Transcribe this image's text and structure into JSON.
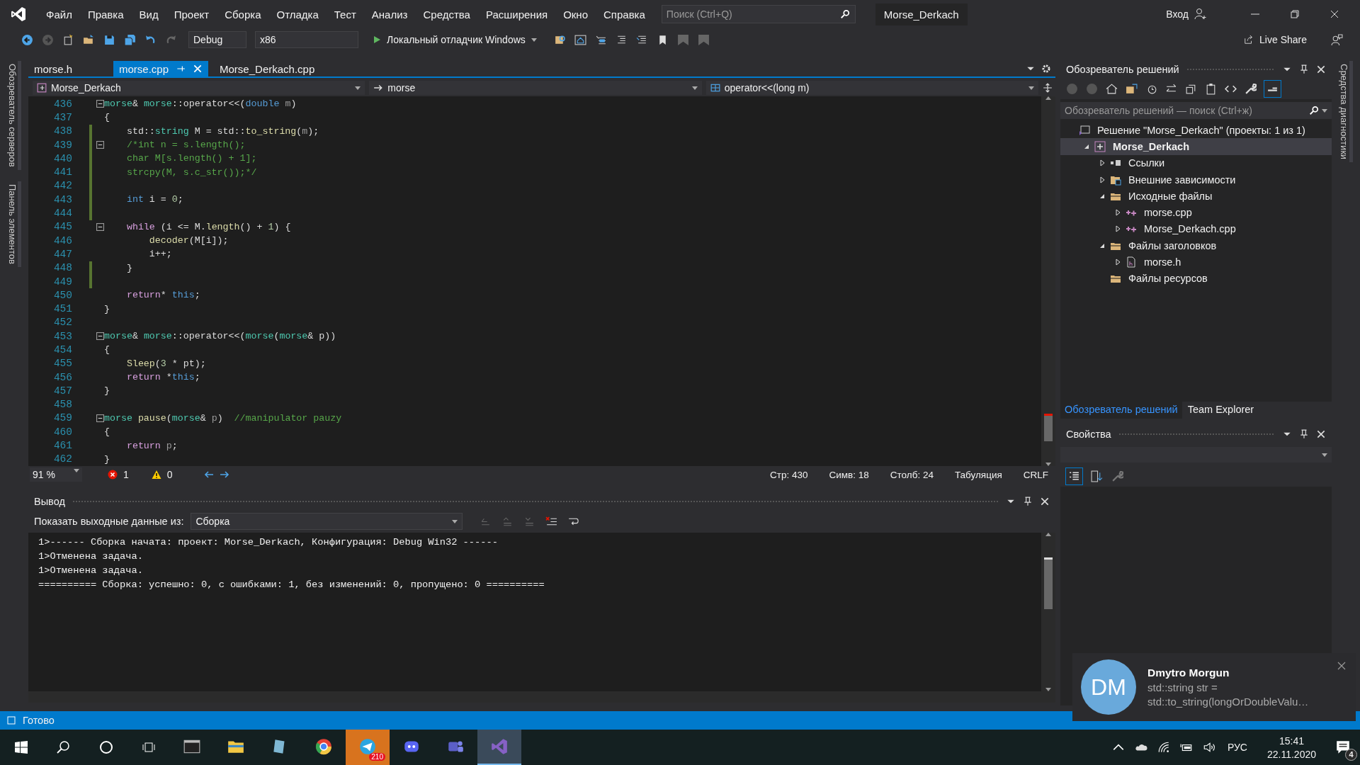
{
  "menu": {
    "items": [
      "Файл",
      "Правка",
      "Вид",
      "Проект",
      "Сборка",
      "Отладка",
      "Тест",
      "Анализ",
      "Средства",
      "Расширения",
      "Окно",
      "Справка"
    ]
  },
  "search": {
    "placeholder": "Поиск (Ctrl+Q)"
  },
  "window": {
    "title": "Morse_Derkach"
  },
  "account": {
    "label": "Вход"
  },
  "toolbar": {
    "configuration": "Debug",
    "platform": "x86",
    "debugger": "Локальный отладчик Windows",
    "live_share": "Live Share"
  },
  "side_tabs_left": [
    "Обозреватель серверов",
    "Панель элементов"
  ],
  "side_tabs_right": [
    "Средства диагностики"
  ],
  "editor": {
    "tabs": [
      {
        "label": "morse.h",
        "selected": false
      },
      {
        "label": "morse.cpp",
        "selected": true
      },
      {
        "label": "Morse_Derkach.cpp",
        "selected": false
      }
    ],
    "navigation": [
      "Morse_Derkach",
      "morse",
      "operator<<(long m)"
    ],
    "lines": [
      {
        "number": "436",
        "changed": false,
        "fold": true,
        "tokens": [
          {
            "kind": "type",
            "text": "morse"
          },
          {
            "kind": "plain",
            "text": "& "
          },
          {
            "kind": "type",
            "text": "morse"
          },
          {
            "kind": "plain",
            "text": "::operator<<("
          },
          {
            "kind": "keyword",
            "text": "double"
          },
          {
            "kind": "param",
            "text": " m"
          },
          {
            "kind": "plain",
            "text": ")"
          }
        ]
      },
      {
        "number": "437",
        "changed": false,
        "fold": false,
        "tokens": [
          {
            "kind": "plain",
            "text": "{"
          }
        ]
      },
      {
        "number": "438",
        "changed": true,
        "fold": false,
        "tokens": [
          {
            "kind": "plain",
            "text": "    std::"
          },
          {
            "kind": "type",
            "text": "string"
          },
          {
            "kind": "plain",
            "text": " M = std::"
          },
          {
            "kind": "function",
            "text": "to_string"
          },
          {
            "kind": "plain",
            "text": "("
          },
          {
            "kind": "param",
            "text": "m"
          },
          {
            "kind": "plain",
            "text": ");"
          }
        ]
      },
      {
        "number": "439",
        "changed": true,
        "fold": true,
        "tokens": [
          {
            "kind": "comment",
            "text": "    /*int n = s.length();"
          }
        ]
      },
      {
        "number": "440",
        "changed": true,
        "fold": false,
        "tokens": [
          {
            "kind": "comment",
            "text": "    char M[s.length() + 1];"
          }
        ]
      },
      {
        "number": "441",
        "changed": true,
        "fold": false,
        "tokens": [
          {
            "kind": "comment",
            "text": "    strcpy(M, s.c_str());*/"
          }
        ]
      },
      {
        "number": "442",
        "changed": true,
        "fold": false
      },
      {
        "number": "443",
        "changed": true,
        "fold": false,
        "tokens": [
          {
            "kind": "keyword",
            "text": "    int"
          },
          {
            "kind": "plain",
            "text": " i = "
          },
          {
            "kind": "number",
            "text": "0"
          },
          {
            "kind": "plain",
            "text": ";"
          }
        ]
      },
      {
        "number": "444",
        "changed": true,
        "fold": false
      },
      {
        "number": "445",
        "changed": false,
        "fold": true,
        "tokens": [
          {
            "kind": "control",
            "text": "    while"
          },
          {
            "kind": "plain",
            "text": " (i <= M."
          },
          {
            "kind": "function",
            "text": "length"
          },
          {
            "kind": "plain",
            "text": "() + "
          },
          {
            "kind": "number",
            "text": "1"
          },
          {
            "kind": "plain",
            "text": ") {"
          }
        ]
      },
      {
        "number": "446",
        "changed": false,
        "fold": false,
        "tokens": [
          {
            "kind": "function",
            "text": "        decoder"
          },
          {
            "kind": "plain",
            "text": "(M[i]);"
          }
        ]
      },
      {
        "number": "447",
        "changed": false,
        "fold": false,
        "tokens": [
          {
            "kind": "plain",
            "text": "        i++;"
          }
        ]
      },
      {
        "number": "448",
        "changed": true,
        "fold": false,
        "tokens": [
          {
            "kind": "plain",
            "text": "    }"
          }
        ]
      },
      {
        "number": "449",
        "changed": true,
        "fold": false
      },
      {
        "number": "450",
        "changed": false,
        "fold": false,
        "tokens": [
          {
            "kind": "control",
            "text": "    return"
          },
          {
            "kind": "plain",
            "text": "* "
          },
          {
            "kind": "keyword",
            "text": "this"
          },
          {
            "kind": "plain",
            "text": ";"
          }
        ]
      },
      {
        "number": "451",
        "changed": false,
        "fold": false,
        "tokens": [
          {
            "kind": "plain",
            "text": "}"
          }
        ]
      },
      {
        "number": "452",
        "changed": false,
        "fold": false
      },
      {
        "number": "453",
        "changed": false,
        "fold": true,
        "tokens": [
          {
            "kind": "type",
            "text": "morse"
          },
          {
            "kind": "plain",
            "text": "& "
          },
          {
            "kind": "type",
            "text": "morse"
          },
          {
            "kind": "plain",
            "text": "::operator<<("
          },
          {
            "kind": "type",
            "text": "morse"
          },
          {
            "kind": "plain",
            "text": "("
          },
          {
            "kind": "type",
            "text": "morse"
          },
          {
            "kind": "plain",
            "text": "& p))"
          }
        ]
      },
      {
        "number": "454",
        "changed": false,
        "fold": false,
        "tokens": [
          {
            "kind": "plain",
            "text": "{"
          }
        ]
      },
      {
        "number": "455",
        "changed": false,
        "fold": false,
        "tokens": [
          {
            "kind": "function",
            "text": "    Sleep"
          },
          {
            "kind": "plain",
            "text": "("
          },
          {
            "kind": "number",
            "text": "3"
          },
          {
            "kind": "plain",
            "text": " * pt);"
          }
        ]
      },
      {
        "number": "456",
        "changed": false,
        "fold": false,
        "tokens": [
          {
            "kind": "control",
            "text": "    return"
          },
          {
            "kind": "plain",
            "text": " *"
          },
          {
            "kind": "keyword",
            "text": "this"
          },
          {
            "kind": "plain",
            "text": ";"
          }
        ]
      },
      {
        "number": "457",
        "changed": false,
        "fold": false,
        "tokens": [
          {
            "kind": "plain",
            "text": "}"
          }
        ]
      },
      {
        "number": "458",
        "changed": false,
        "fold": false
      },
      {
        "number": "459",
        "changed": false,
        "fold": true,
        "tokens": [
          {
            "kind": "type",
            "text": "morse"
          },
          {
            "kind": "function",
            "text": " pause"
          },
          {
            "kind": "plain",
            "text": "("
          },
          {
            "kind": "type",
            "text": "morse"
          },
          {
            "kind": "plain",
            "text": "& "
          },
          {
            "kind": "param",
            "text": "p"
          },
          {
            "kind": "plain",
            "text": ")  "
          },
          {
            "kind": "comment",
            "text": "//manipulator pauzy"
          }
        ]
      },
      {
        "number": "460",
        "changed": false,
        "fold": false,
        "tokens": [
          {
            "kind": "plain",
            "text": "{"
          }
        ]
      },
      {
        "number": "461",
        "changed": false,
        "fold": false,
        "tokens": [
          {
            "kind": "control",
            "text": "    return"
          },
          {
            "kind": "param",
            "text": " p"
          },
          {
            "kind": "plain",
            "text": ";"
          }
        ]
      },
      {
        "number": "462",
        "changed": false,
        "fold": false,
        "tokens": [
          {
            "kind": "plain",
            "text": "}"
          }
        ]
      }
    ],
    "status": {
      "zoom": "91 %",
      "errors": "1",
      "warnings": "0",
      "line": "Стр: 430",
      "char": "Симв: 18",
      "column": "Столб: 24",
      "indent": "Табуляция",
      "line_endings": "CRLF"
    }
  },
  "output": {
    "title": "Вывод",
    "source_label": "Показать выходные данные из:",
    "source": "Сборка",
    "lines": [
      "1>------ Сборка начата: проект: Morse_Derkach, Конфигурация: Debug Win32 ------",
      "1>Отменена задача.",
      "1>Отменена задача.",
      "========== Сборка: успешно: 0, с ошибками: 1, без изменений: 0, пропущено: 0 =========="
    ]
  },
  "solution_explorer": {
    "title": "Обозреватель решений",
    "search_placeholder": "Обозреватель решений — поиск (Ctrl+ж)",
    "tree": [
      {
        "kind": "solution",
        "label": "Решение \"Morse_Derkach\" (проекты: 1 из 1)",
        "selected": false,
        "children": [
          {
            "kind": "project",
            "label": "Morse_Derkach",
            "selected": true,
            "expanded": true,
            "children": [
              {
                "kind": "references",
                "label": "Ссылки",
                "selected": false,
                "expanded": false
              },
              {
                "kind": "external",
                "label": "Внешние зависимости",
                "selected": false,
                "expanded": false
              },
              {
                "kind": "folder",
                "label": "Исходные файлы",
                "selected": false,
                "expanded": true,
                "children": [
                  {
                    "kind": "cpp",
                    "label": "morse.cpp",
                    "selected": false,
                    "expanded": false
                  },
                  {
                    "kind": "cpp",
                    "label": "Morse_Derkach.cpp",
                    "selected": false,
                    "expanded": false
                  }
                ]
              },
              {
                "kind": "folder",
                "label": "Файлы заголовков",
                "selected": false,
                "expanded": true,
                "children": [
                  {
                    "kind": "header",
                    "label": "morse.h",
                    "selected": false,
                    "expanded": false
                  }
                ]
              },
              {
                "kind": "folder",
                "label": "Файлы ресурсов",
                "selected": false
              }
            ]
          }
        ]
      }
    ],
    "tabs": [
      {
        "label": "Обозреватель решений",
        "selected": true
      },
      {
        "label": "Team Explorer",
        "selected": false
      }
    ]
  },
  "properties": {
    "title": "Свойства"
  },
  "status_bar": {
    "text": "Готово"
  },
  "notification": {
    "initials": "DM",
    "sender": "Dmytro Morgun",
    "lines": [
      "std::string str =",
      "std::to_string(longOrDoubleValu…"
    ]
  },
  "taskbar": {
    "apps": [
      {
        "kind": "terminal",
        "active": false,
        "flashing": false
      },
      {
        "kind": "explorer",
        "active": false,
        "flashing": false
      },
      {
        "kind": "notes",
        "active": false,
        "flashing": false
      },
      {
        "kind": "browser",
        "active": false,
        "flashing": false
      },
      {
        "kind": "messenger",
        "active": false,
        "flashing": true,
        "badge": "210"
      },
      {
        "kind": "chat",
        "active": false,
        "flashing": false
      },
      {
        "kind": "teams",
        "active": false,
        "flashing": false
      },
      {
        "kind": "ide",
        "active": true,
        "flashing": false
      }
    ],
    "language": "РУС",
    "time": "15:41",
    "date": "22.11.2020",
    "notification_count": "4"
  }
}
